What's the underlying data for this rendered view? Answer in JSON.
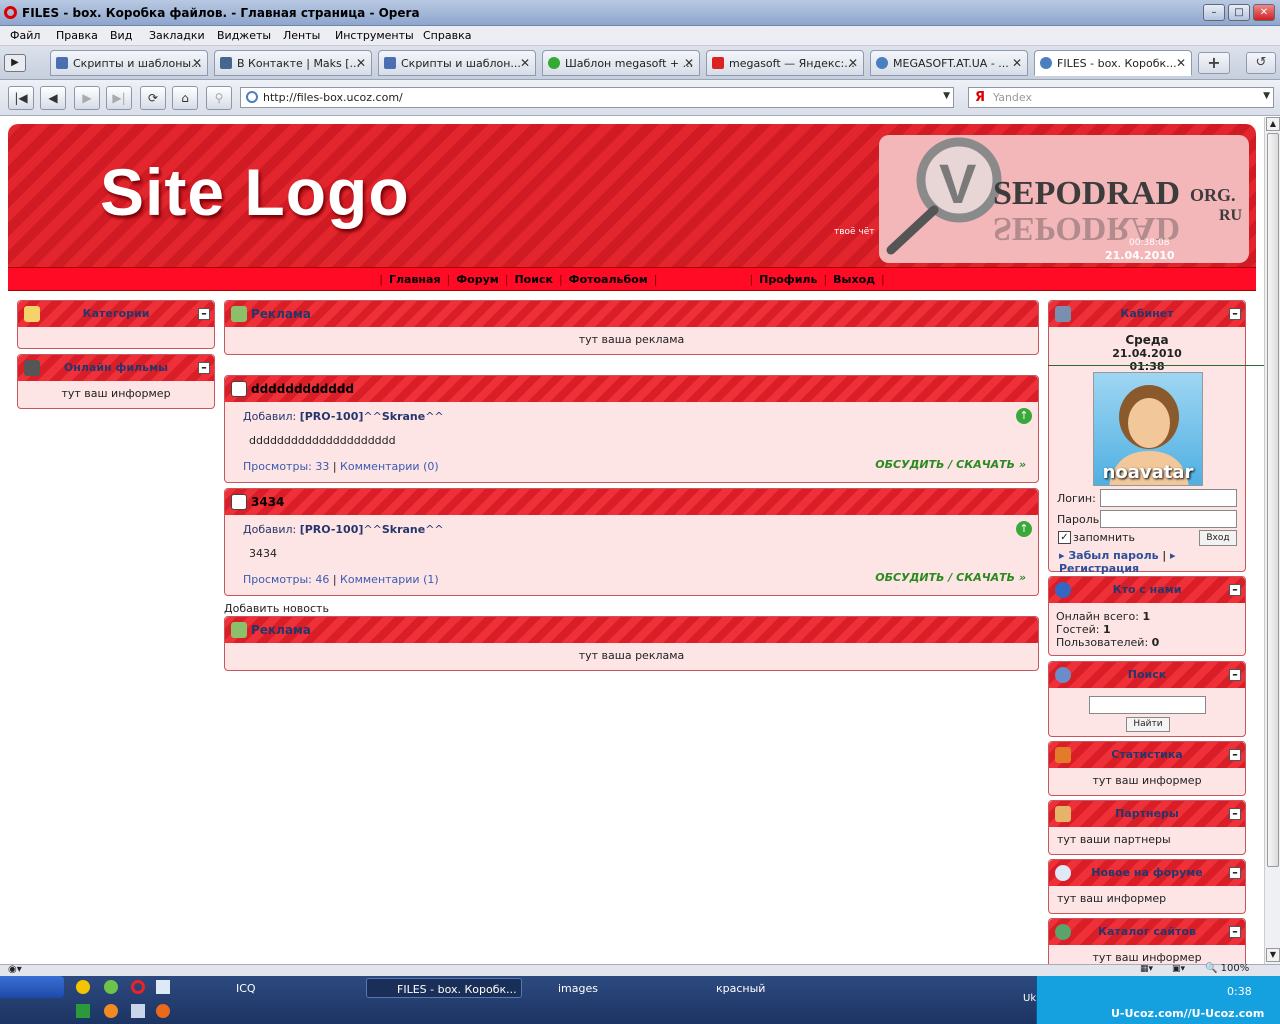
{
  "window": {
    "title": "FILES - box. Коробка файлов. - Главная страница - Opera"
  },
  "menu": [
    "Файл",
    "Правка",
    "Вид",
    "Закладки",
    "Виджеты",
    "Ленты",
    "Инструменты",
    "Справка"
  ],
  "tabs": [
    {
      "label": "Скрипты и шаблоны...",
      "color": "#4a6fb3"
    },
    {
      "label": "В Контакте | Maks [...",
      "color": "#45668e"
    },
    {
      "label": "Скрипты и шаблон...",
      "color": "#4a6fb3"
    },
    {
      "label": "Шаблон megasoft + ...",
      "color": "#36a834"
    },
    {
      "label": "megasoft — Яндекс:...",
      "color": "#d22"
    },
    {
      "label": "MEGASOFT.AT.UA - ...",
      "color": "#4a7fc0"
    },
    {
      "label": "FILES - box. Коробк...",
      "color": "#4a7fc0"
    }
  ],
  "address": {
    "url": "http://files-box.ucoz.com/",
    "search_placeholder": "Yandex"
  },
  "site": {
    "logo": "Site Logo",
    "tagline": "твоё чёт",
    "banner_brand": "SEPODRAD",
    "banner_suffix1": "ORG.",
    "banner_suffix2": "RU",
    "time": "00:38:08",
    "date": "21.04.2010",
    "nav": [
      "Главная",
      "Форум",
      "Поиск",
      "Фотоальбом",
      "Профиль",
      "Выход"
    ]
  },
  "left": {
    "categories": "Категории",
    "films": "Онлайн фильмы",
    "films_body": "тут ваш информер"
  },
  "center": {
    "ad_title": "Реклама",
    "ad_body": "тут ваша реклама",
    "posts": [
      {
        "title": "dddddddddddd",
        "added": "Добавил:",
        "author_prefix": "[PRO-100]",
        "author_mid": "^^",
        "author_name": "Skrane",
        "author_suffix": "^^",
        "text": "ddddddddddddddddddddd",
        "views": "Просмотры: 33",
        "comments": "Комментарии (0)",
        "more": "ОБСУДИТЬ / СКАЧАТЬ »"
      },
      {
        "title": "3434",
        "added": "Добавил:",
        "author_prefix": "[PRO-100]",
        "author_mid": "^^",
        "author_name": "Skrane",
        "author_suffix": "^^",
        "text": "3434",
        "views": "Просмотры: 46",
        "comments": "Комментарии (1)",
        "more": "ОБСУДИТЬ / СКАЧАТЬ »"
      }
    ],
    "add_news": "Добавить новость"
  },
  "right": {
    "cabinet": "Кабинет",
    "day": "Среда",
    "date": "21.04.2010",
    "time": "01:38",
    "avatar_label": "noavatar",
    "login_label": "Логин:",
    "password_label": "Пароль:",
    "remember": "запомнить",
    "enter": "Вход",
    "forgot": "Забыл пароль",
    "register": "Регистрация",
    "who": "Кто с нами",
    "online_label": "Онлайн всего:",
    "online_value": "1",
    "guests_label": "Гостей:",
    "guests_value": "1",
    "users_label": "Пользователей:",
    "users_value": "0",
    "search": "Поиск",
    "find": "Найти",
    "stats": "Статистика",
    "stats_body": "тут ваш информер",
    "partners": "Партнеры",
    "partners_body": "тут ваши партнеры",
    "forum_new": "Новое на форуме",
    "forum_body": "тут ваш информер",
    "catalog": "Каталог сайтов",
    "catalog_body": "тут ваш информер"
  },
  "status": {
    "zoom": "100%"
  },
  "taskbar": {
    "items": [
      "ICQ",
      "FILES - box. Коробк...",
      "images",
      "красный"
    ],
    "lang": "Uk",
    "clock": "0:38",
    "watermark": "U-Ucoz.com//U-Ucoz.com"
  }
}
